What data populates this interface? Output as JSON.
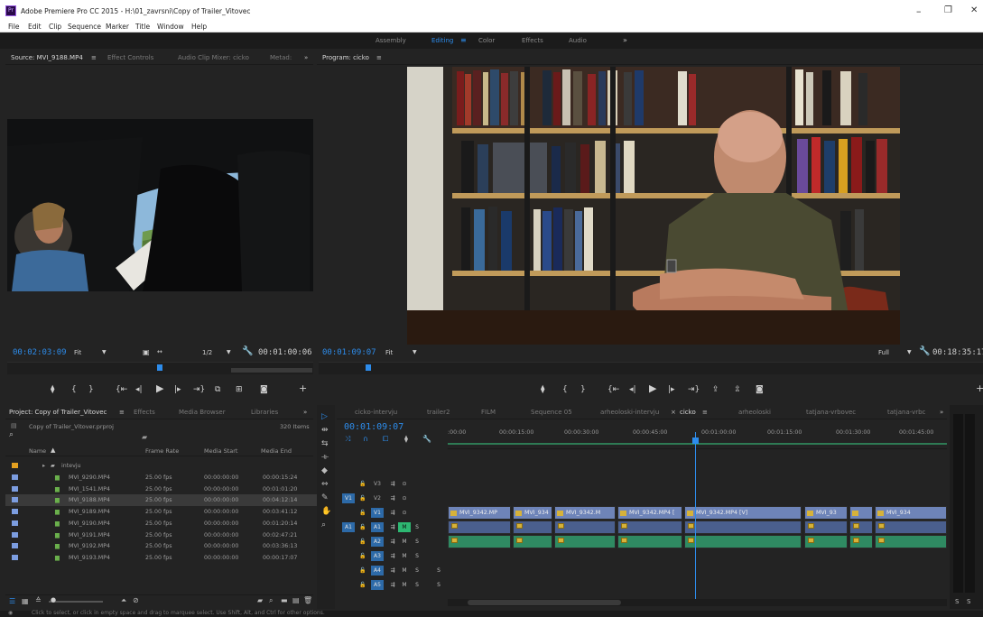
{
  "window": {
    "title": "Adobe Premiere Pro CC 2015 - H:\\01_zavrsni\\Copy of Trailer_Vitovec",
    "icon_label": "Pr",
    "minimize": "–",
    "restore": "❐",
    "close": "✕"
  },
  "menu": [
    "File",
    "Edit",
    "Clip",
    "Sequence",
    "Marker",
    "Title",
    "Window",
    "Help"
  ],
  "workspaces": [
    {
      "label": "Assembly",
      "active": false
    },
    {
      "label": "Editing",
      "active": true
    },
    {
      "label": "≡",
      "active": true
    },
    {
      "label": "Color",
      "active": false
    },
    {
      "label": "Effects",
      "active": false
    },
    {
      "label": "Audio",
      "active": false
    },
    {
      "label": "»",
      "active": false
    }
  ],
  "source_monitor": {
    "tabs": [
      "Source: MVI_9188.MP4",
      "≡",
      "Effect Controls",
      "Audio Clip Mixer: cicko",
      "Metad:",
      "»"
    ],
    "timecode": "00:02:03:09",
    "fit": "Fit",
    "resolution": "1/2",
    "duration": "00:01:00:06",
    "playhead_fraction": 0.49
  },
  "program_monitor": {
    "title": "Program: cicko",
    "menu": "≡",
    "timecode": "00:01:09:07",
    "fit": "Fit",
    "full": "Full",
    "duration": "00:18:35:17",
    "playhead_fraction": 0.07
  },
  "project": {
    "tabs": [
      "Project: Copy of Trailer_Vitovec",
      "≡",
      "Effects",
      "Media Browser",
      "Libraries",
      "»"
    ],
    "file": "Copy of Trailer_Vitover.prproj",
    "items_count": "320 Items",
    "search_icon": "⌕",
    "columns": [
      "Name",
      "Frame Rate",
      "Media Start",
      "Media End"
    ],
    "sort_indicator": "▲",
    "folder": "intevju",
    "rows": [
      {
        "name": "MVI_9290.MP4",
        "fps": "25.00 fps",
        "start": "00:00:00:00",
        "end": "00:00:15:24",
        "selected": false
      },
      {
        "name": "MVI_1541.MP4",
        "fps": "25.00 fps",
        "start": "00:00:00:00",
        "end": "00:01:01:20",
        "selected": false
      },
      {
        "name": "MVI_9188.MP4",
        "fps": "25.00 fps",
        "start": "00:00:00:00",
        "end": "00:04:12:14",
        "selected": true
      },
      {
        "name": "MVI_9189.MP4",
        "fps": "25.00 fps",
        "start": "00:00:00:00",
        "end": "00:03:41:12",
        "selected": false
      },
      {
        "name": "MVI_9190.MP4",
        "fps": "25.00 fps",
        "start": "00:00:00:00",
        "end": "00:01:20:14",
        "selected": false
      },
      {
        "name": "MVI_9191.MP4",
        "fps": "25.00 fps",
        "start": "00:00:00:00",
        "end": "00:02:47:21",
        "selected": false
      },
      {
        "name": "MVI_9192.MP4",
        "fps": "25.00 fps",
        "start": "00:00:00:00",
        "end": "00:03:36:13",
        "selected": false
      },
      {
        "name": "MVI_9193.MP4",
        "fps": "25.00 fps",
        "start": "00:00:00:00",
        "end": "00:00:17:07",
        "selected": false
      }
    ]
  },
  "timeline": {
    "tabs": [
      {
        "label": "cicko-intervju",
        "active": false
      },
      {
        "label": "trailer2",
        "active": false
      },
      {
        "label": "FILM",
        "active": false
      },
      {
        "label": "Sequence 05",
        "active": false
      },
      {
        "label": "arheoloski-intervju",
        "active": false
      },
      {
        "label": "cicko",
        "active": true
      },
      {
        "label": "arheoloski",
        "active": false
      },
      {
        "label": "tatjana-vrbovec",
        "active": false
      },
      {
        "label": "tatjana-vrbc",
        "active": false
      }
    ],
    "close_mark": "×",
    "menu": "≡",
    "overflow": "»",
    "timecode": "00:01:09:07",
    "ruler": [
      ":00:00",
      "00:00:15:00",
      "00:00:30:00",
      "00:00:45:00",
      "00:01:00:00",
      "00:01:15:00",
      "00:01:30:00",
      "00:01:45:00"
    ],
    "playhead_fraction": 0.495,
    "tracks": [
      {
        "id": "V3",
        "type": "video",
        "src": "",
        "eye": "⊙"
      },
      {
        "id": "V2",
        "type": "video",
        "src": "V1",
        "eye": "⊙"
      },
      {
        "id": "V1",
        "type": "video",
        "src": "",
        "eye": "⊙"
      },
      {
        "id": "A1",
        "type": "audio",
        "src": "A1",
        "m": "M",
        "s": "S"
      },
      {
        "id": "A2",
        "type": "audio",
        "src": "",
        "m": "M",
        "s": "S"
      },
      {
        "id": "A3",
        "type": "audio",
        "src": "",
        "m": "M",
        "s": "S"
      },
      {
        "id": "A4",
        "type": "audio",
        "src": "",
        "m": "M",
        "s": "S"
      },
      {
        "id": "A5",
        "type": "audio",
        "src": "",
        "m": "M",
        "s": "S"
      }
    ],
    "video_clips": [
      "MVI_9342.MP",
      "MVI_934",
      "MVI_9342.M",
      "MVI_9342.MP4 [",
      "MVI_9342.MP4 [V]",
      "MVI_93",
      "",
      "MVI_934"
    ],
    "audio_sources": "S",
    "meter_labels": [
      "S",
      "S"
    ]
  },
  "tools": [
    "▷",
    "⇹",
    "⇆",
    "⟛",
    "⇔",
    "✎",
    "⧈",
    "✋",
    "⌕"
  ],
  "status": {
    "text": "Click to select, or click in empty space and drag to marquee select. Use Shift, Alt, and Ctrl for other options."
  },
  "colors": {
    "accent": "#2d8ceb",
    "video_clip": "#6e84b8",
    "audio_clip": "#2f8a62",
    "label_swatch": "#7c9de0",
    "folder_swatch": "#e3a020"
  }
}
